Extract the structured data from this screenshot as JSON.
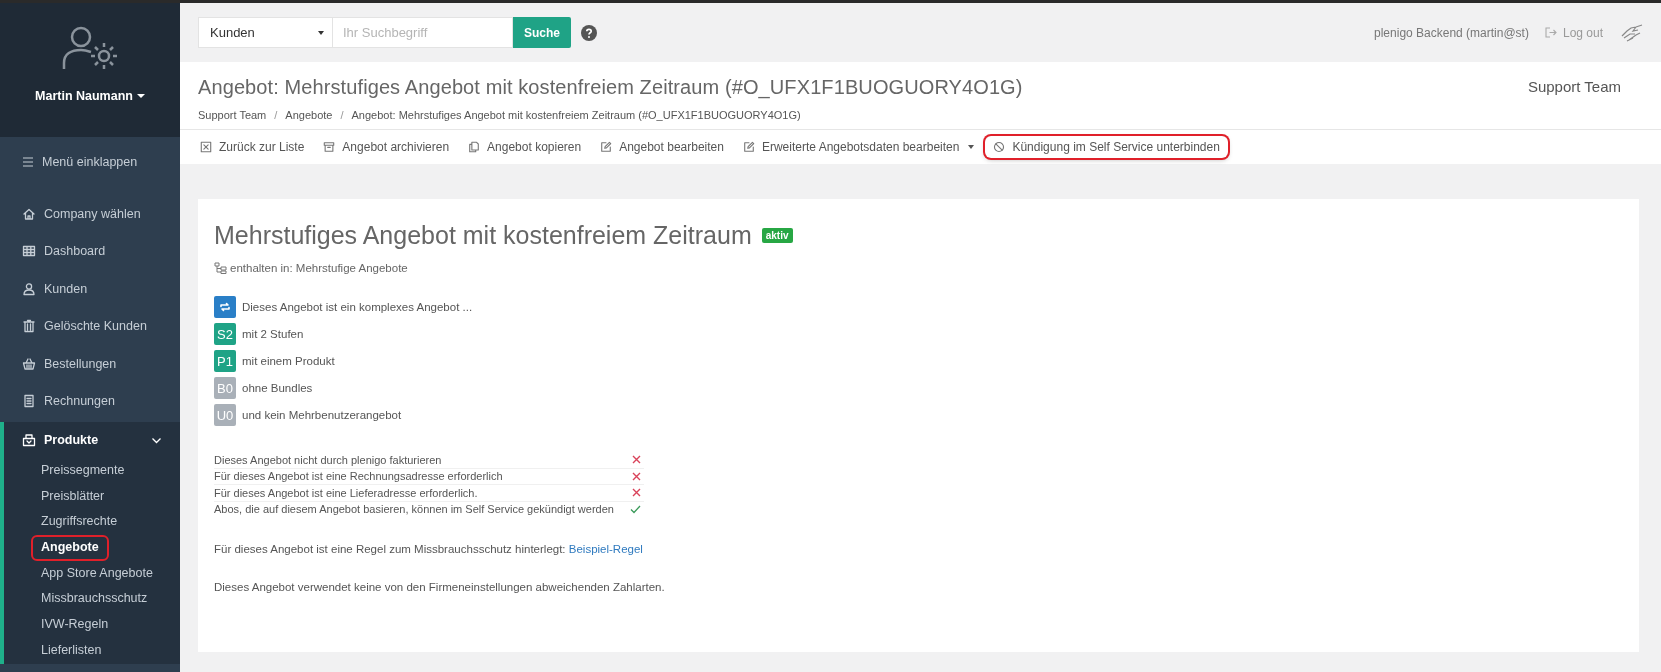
{
  "sidebar": {
    "user_name": "Martin Naumann",
    "collapse_label": "Menü einklappen",
    "items": [
      {
        "label": "Company wählen",
        "kind": "home"
      },
      {
        "label": "Dashboard",
        "kind": "grid"
      },
      {
        "label": "Kunden",
        "kind": "user"
      },
      {
        "label": "Gelöschte Kunden",
        "kind": "trash"
      },
      {
        "label": "Bestellungen",
        "kind": "basket"
      },
      {
        "label": "Rechnungen",
        "kind": "doc"
      }
    ],
    "section": {
      "label": "Produkte",
      "expanded": true,
      "children": [
        {
          "label": "Preissegmente",
          "selected": false,
          "highlighted": false
        },
        {
          "label": "Preisblätter",
          "selected": false,
          "highlighted": false
        },
        {
          "label": "Zugriffsrechte",
          "selected": false,
          "highlighted": false
        },
        {
          "label": "Angebote",
          "selected": true,
          "highlighted": true
        },
        {
          "label": "App Store Angebote",
          "selected": false,
          "highlighted": false
        },
        {
          "label": "Missbrauchsschutz",
          "selected": false,
          "highlighted": false
        },
        {
          "label": "IVW-Regeln",
          "selected": false,
          "highlighted": false
        },
        {
          "label": "Lieferlisten",
          "selected": false,
          "highlighted": false
        }
      ]
    }
  },
  "topbar": {
    "search_scope": "Kunden",
    "search": {
      "placeholder": "Ihr Suchbegriff"
    },
    "search_button": "Suche",
    "account": "plenigo Backend (martin@st)",
    "logout": "Log out"
  },
  "header": {
    "title": "Angebot: Mehrstufiges Angebot mit kostenfreiem Zeitraum (#O_UFX1F1BUOGUORY4O1G)",
    "team": "Support Team",
    "breadcrumb_separator": "/",
    "breadcrumbs": [
      "Support Team",
      "Angebote",
      "Angebot: Mehrstufiges Angebot mit kostenfreiem Zeitraum (#O_UFX1F1BUOGUORY4O1G)"
    ]
  },
  "toolbar": [
    {
      "label": "Zurück zur Liste",
      "kind": "close",
      "dropdown": false,
      "highlighted": false
    },
    {
      "label": "Angebot archivieren",
      "kind": "archive",
      "dropdown": false,
      "highlighted": false
    },
    {
      "label": "Angebot kopieren",
      "kind": "copy",
      "dropdown": false,
      "highlighted": false
    },
    {
      "label": "Angebot bearbeiten",
      "kind": "edit",
      "dropdown": false,
      "highlighted": false
    },
    {
      "label": "Erweiterte Angebotsdaten bearbeiten",
      "kind": "edit",
      "dropdown": true,
      "highlighted": false
    },
    {
      "label": "Kündigung im Self Service unterbinden",
      "kind": "ban",
      "dropdown": false,
      "highlighted": true
    }
  ],
  "offer": {
    "title": "Mehrstufiges Angebot mit kostenfreiem Zeitraum",
    "status": "aktiv",
    "contained_in": "enthalten in: Mehrstufige Angebote",
    "features": [
      {
        "kind": "icon",
        "color": "#2a7fc7",
        "text": "Dieses Angebot ist ein komplexes Angebot ..."
      },
      {
        "kind": "text",
        "badge": "S2",
        "color": "#1fa386",
        "text": "mit 2 Stufen"
      },
      {
        "kind": "text",
        "badge": "P1",
        "color": "#1fa386",
        "text": "mit einem Produkt"
      },
      {
        "kind": "text",
        "badge": "B0",
        "color": "#a9b0b8",
        "text": "ohne Bundles"
      },
      {
        "kind": "text",
        "badge": "U0",
        "color": "#a9b0b8",
        "text": "und kein Mehrbenutzerangebot"
      }
    ],
    "flags": [
      {
        "text": "Dieses Angebot nicht durch plenigo fakturieren",
        "checked": false
      },
      {
        "text": "Für dieses Angebot ist eine Rechnungsadresse erforderlich",
        "checked": false
      },
      {
        "text": "Für dieses Angebot ist eine Lieferadresse erforderlich.",
        "checked": false
      },
      {
        "text": "Abos, die auf diesem Angebot basieren, können im Self Service gekündigt werden",
        "checked": true
      }
    ],
    "rule_text": "Für dieses Angebot ist eine Regel zum Missbrauchsschutz hinterlegt:",
    "rule_link": "Beispiel-Regel",
    "payment_note": "Dieses Angebot verwendet keine von den Firmeneinstellungen abweichenden Zahlarten."
  }
}
